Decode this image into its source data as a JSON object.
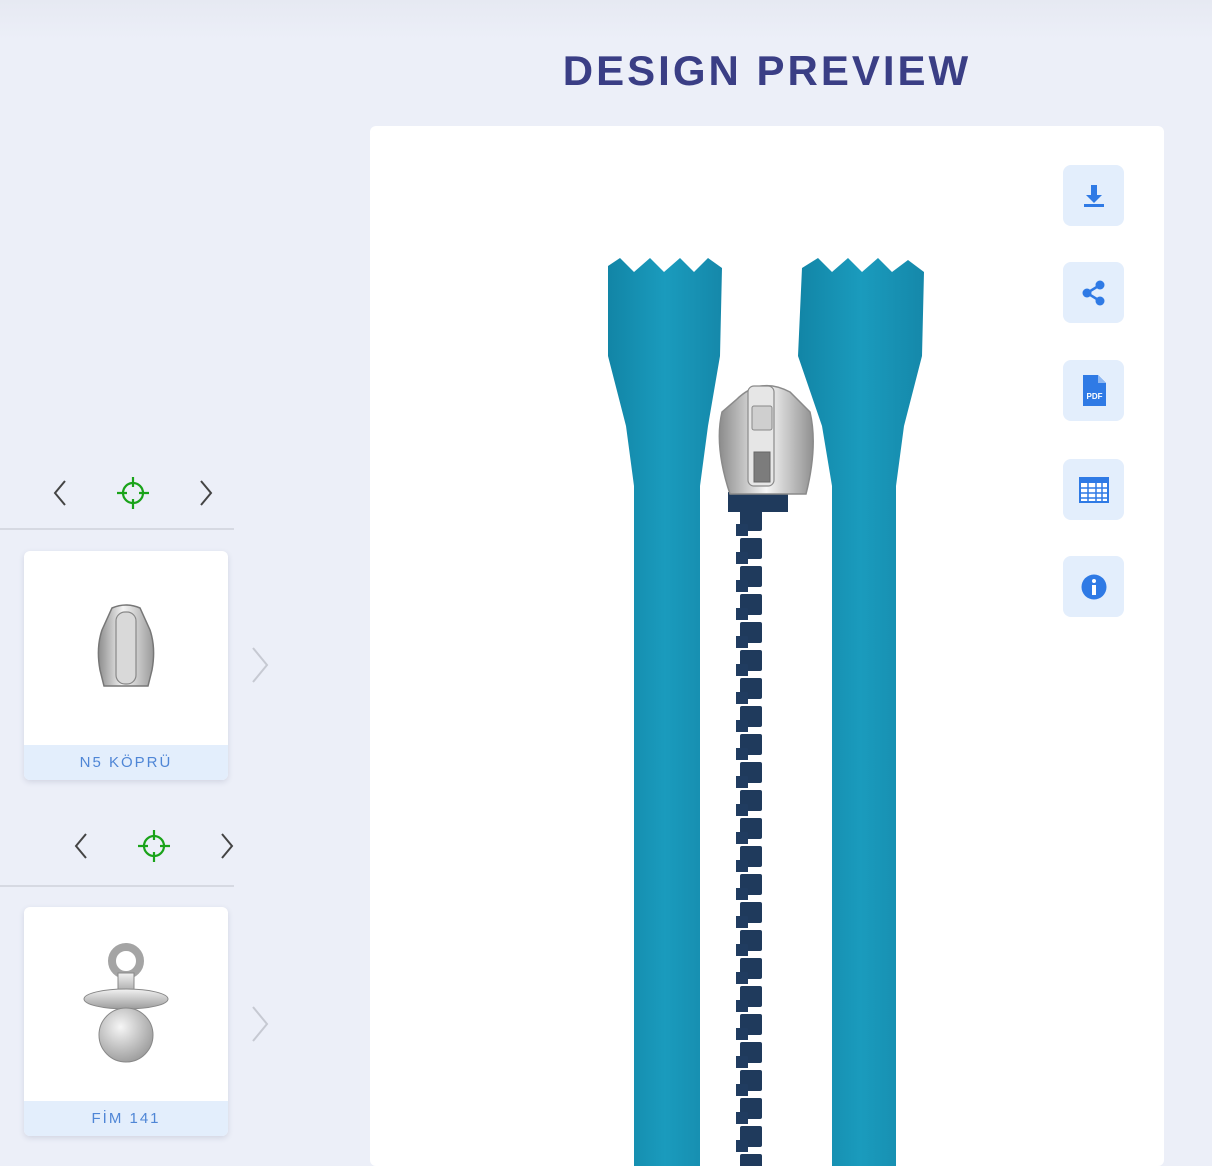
{
  "header": {
    "title": "DESIGN PREVIEW"
  },
  "selectors": [
    {
      "card_label": "N5 KÖPRÜ",
      "part": "slider-body"
    },
    {
      "card_label": "FİM 141",
      "part": "puller"
    }
  ],
  "toolbar": {
    "items": [
      "download-icon",
      "share-icon",
      "pdf-icon",
      "spreadsheet-icon",
      "info-icon"
    ],
    "pdf_badge": "PDF"
  },
  "colors": {
    "accent": "#2f7ae5",
    "target_green": "#1aa31a",
    "tape": "#1796b6",
    "teeth": "#1f3a5c",
    "title": "#3a3e85"
  }
}
